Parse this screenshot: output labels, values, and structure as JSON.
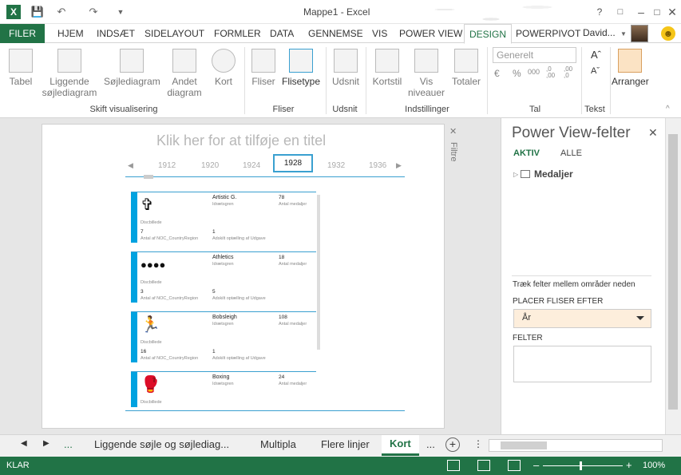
{
  "window": {
    "title": "Mappe1 - Excel"
  },
  "tabs": [
    "FILER",
    "HJEM",
    "INDSÆT",
    "SIDELAYOUT",
    "FORMLER",
    "DATA",
    "GENNEMSE",
    "VIS",
    "POWER VIEW",
    "DESIGN",
    "POWERPIVOT"
  ],
  "user": {
    "name": "David..."
  },
  "ribbon": {
    "buttons": [
      "Tabel",
      "Liggende\nsøjlediagram",
      "Søjlediagram",
      "Andet\ndiagram",
      "Kort",
      "Fliser",
      "Flisetype",
      "Udsnit",
      "Kortstil",
      "Vis\nniveauer",
      "Totaler",
      "Arranger"
    ],
    "number_format": "Generelt",
    "groups": [
      "Skift visualisering",
      "Fliser",
      "Udsnit",
      "Indstillinger",
      "Tal",
      "Tekst"
    ]
  },
  "canvas": {
    "title_placeholder": "Klik her for at tilføje en titel",
    "filter_tab": "Filtre",
    "years": [
      "1912",
      "1920",
      "1924",
      "1928",
      "1932",
      "1936"
    ],
    "selected_year": "1928"
  },
  "cards": [
    {
      "sport": "Artistic G.",
      "sport_sub": "Idrætsgren",
      "medals": "78",
      "medals_label": "Antal medaljer",
      "pic_label": "Discbillede",
      "count_noc": "7",
      "count_noc_label": "Antal af NOC_CountryRegion",
      "distinct": "1",
      "distinct_label": "Adskilt optælling af Udgave"
    },
    {
      "sport": "Athletics",
      "sport_sub": "Idrætsgren",
      "medals": "18",
      "medals_label": "Antal medaljer",
      "pic_label": "Discbillede",
      "count_noc": "3",
      "count_noc_label": "Antal af NOC_CountryRegion",
      "distinct": "5",
      "distinct_label": "Adskilt optælling af Udgave"
    },
    {
      "sport": "Bobsleigh",
      "sport_sub": "Idrætsgren",
      "medals": "108",
      "medals_label": "Antal medaljer",
      "pic_label": "Discbillede",
      "count_noc": "16",
      "count_noc_label": "Antal af NOC_CountryRegion",
      "distinct": "1",
      "distinct_label": "Adskilt optælling af Udgave"
    },
    {
      "sport": "Boxing",
      "sport_sub": "Idrætsgren",
      "medals": "24",
      "medals_label": "Antal medaljer",
      "pic_label": "Discbillede",
      "count_noc": "",
      "count_noc_label": "",
      "distinct": "",
      "distinct_label": ""
    }
  ],
  "pane": {
    "title": "Power View-felter",
    "tab_active": "AKTIV",
    "tab_all": "ALLE",
    "table": "Medaljer",
    "hint": "Træk felter mellem områder neden",
    "tile_by_label": "PLACER FLISER EFTER",
    "tile_by_value": "År",
    "fields_label": "FELTER"
  },
  "sheets": [
    "...",
    "Liggende søjle og  søjlediag...",
    "Multipla",
    "Flere linjer",
    "Kort",
    "..."
  ],
  "active_sheet": "Kort",
  "status": {
    "text": "KLAR",
    "zoom": "100%"
  },
  "colors": {
    "excel_green": "#217346",
    "accent_blue": "#00a2e0"
  }
}
